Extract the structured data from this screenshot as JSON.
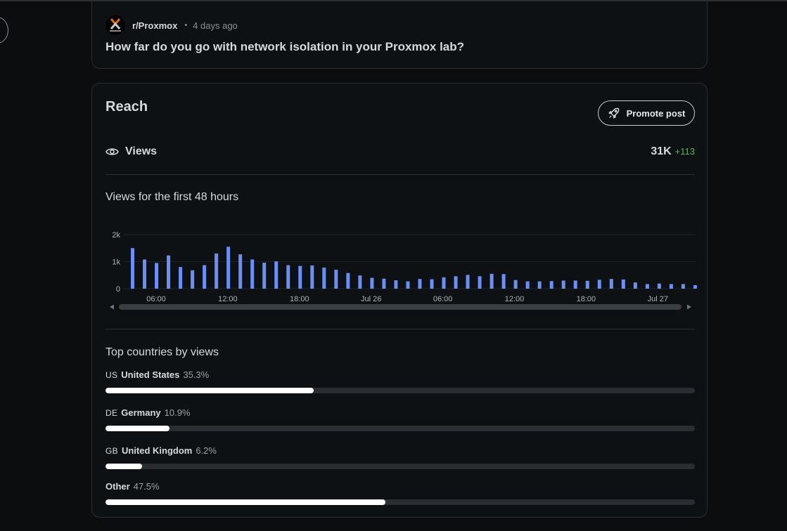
{
  "post": {
    "subreddit": "r/Proxmox",
    "separator": "•",
    "age": "4 days ago",
    "title": "How far do you go with network isolation in your Proxmox lab?",
    "icon": "proxmox-logo-icon"
  },
  "reach": {
    "title": "Reach",
    "promote_label": "Promote post",
    "promote_icon": "rocket-icon",
    "views_label": "Views",
    "views_icon": "eye-icon",
    "views_total": "31K",
    "views_delta": "+113",
    "delta_color": "#4fbf4c"
  },
  "chart_title": "Views for the first 48 hours",
  "chart_data": {
    "type": "bar",
    "title": "Views for the first 48 hours",
    "bar_color": "#6b8ff5",
    "y_ticks": [
      "2k",
      "1k",
      "0"
    ],
    "ylim": [
      0,
      2000
    ],
    "x_ticks": [
      "06:00",
      "12:00",
      "18:00",
      "Jul 26",
      "06:00",
      "12:00",
      "18:00",
      "Jul 27"
    ],
    "values": [
      1500,
      1080,
      950,
      1230,
      800,
      680,
      870,
      1300,
      1550,
      1270,
      1080,
      960,
      1010,
      870,
      840,
      860,
      780,
      700,
      580,
      490,
      400,
      370,
      310,
      270,
      360,
      350,
      420,
      460,
      510,
      460,
      550,
      540,
      320,
      270,
      270,
      280,
      300,
      300,
      290,
      330,
      360,
      340,
      230,
      170,
      190,
      170,
      170,
      130
    ]
  },
  "countries": {
    "title": "Top countries by views",
    "items": [
      {
        "code": "US",
        "name": "United States",
        "pct_label": "35.3%",
        "fraction": 0.353
      },
      {
        "code": "DE",
        "name": "Germany",
        "pct_label": "10.9%",
        "fraction": 0.109
      },
      {
        "code": "GB",
        "name": "United Kingdom",
        "pct_label": "6.2%",
        "fraction": 0.062
      },
      {
        "code": "",
        "name": "Other",
        "pct_label": "47.5%",
        "fraction": 0.475
      }
    ]
  }
}
